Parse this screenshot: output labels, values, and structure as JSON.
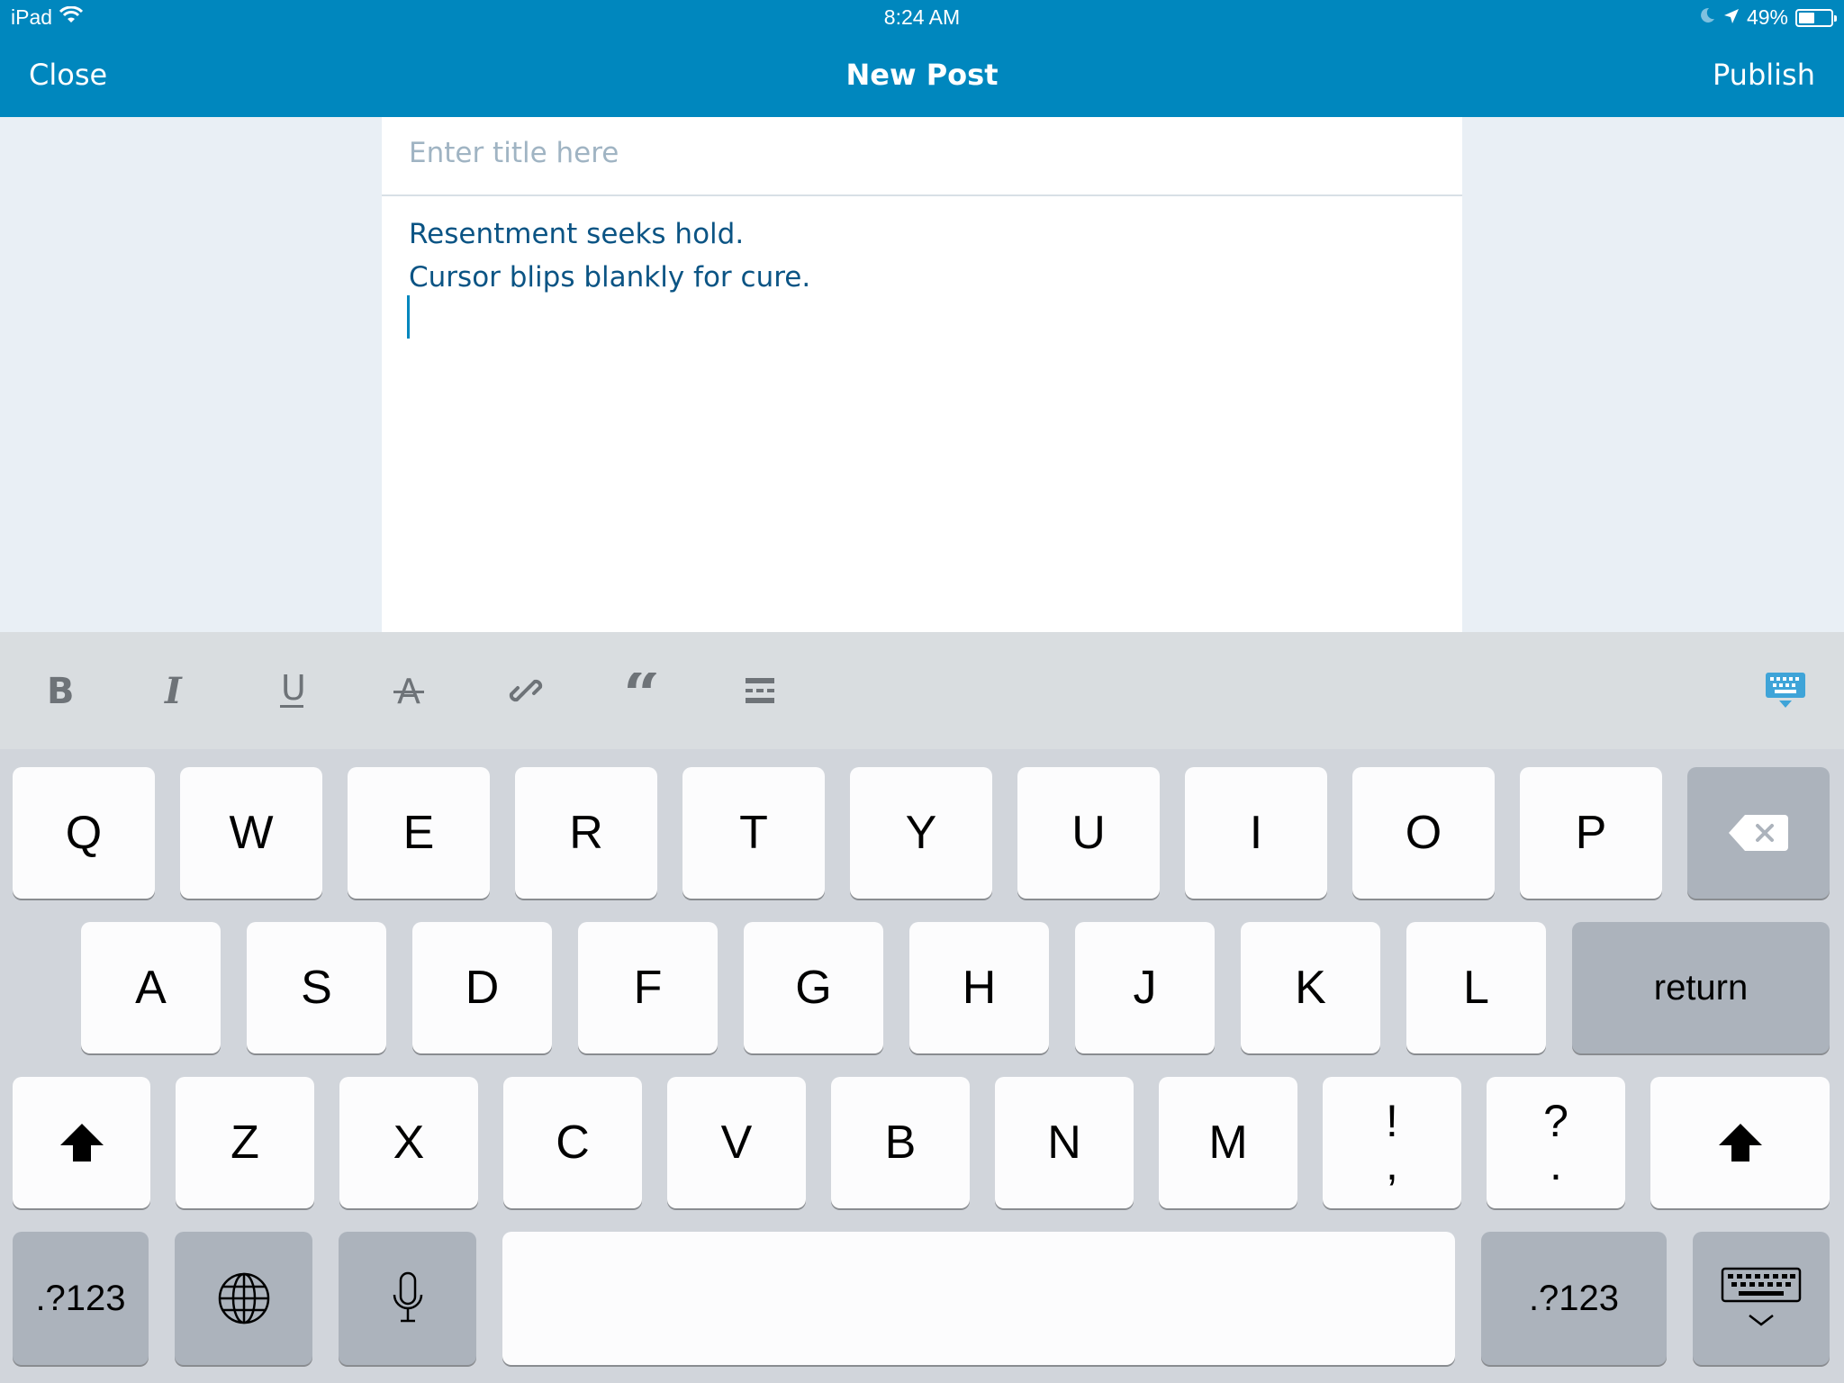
{
  "status": {
    "device": "iPad",
    "time": "8:24 AM",
    "battery": "49%",
    "battery_level": 0.49
  },
  "nav": {
    "close_label": "Close",
    "title": "New Post",
    "publish_label": "Publish"
  },
  "editor": {
    "title_placeholder": "Enter title here",
    "title_value": "",
    "lines": [
      "Resentment seeks hold.",
      "Cursor blips blankly for cure."
    ]
  },
  "format_toolbar": {
    "buttons": [
      "bold",
      "italic",
      "underline",
      "strikethrough",
      "link",
      "blockquote",
      "more"
    ],
    "hide_keyboard_icon": "keyboard-hide-icon",
    "accent": "#3fa4d8"
  },
  "keyboard": {
    "row1": [
      "Q",
      "W",
      "E",
      "R",
      "T",
      "Y",
      "U",
      "I",
      "O",
      "P"
    ],
    "row2": [
      "A",
      "S",
      "D",
      "F",
      "G",
      "H",
      "J",
      "K",
      "L"
    ],
    "return_label": "return",
    "row3": [
      "Z",
      "X",
      "C",
      "V",
      "B",
      "N",
      "M"
    ],
    "punct1": [
      "!",
      ","
    ],
    "punct2": [
      "?",
      "."
    ],
    "numbers_label": ".?123"
  },
  "colors": {
    "header": "#0087be",
    "content_text": "#0b5484",
    "page_bg": "#e9eff5"
  }
}
